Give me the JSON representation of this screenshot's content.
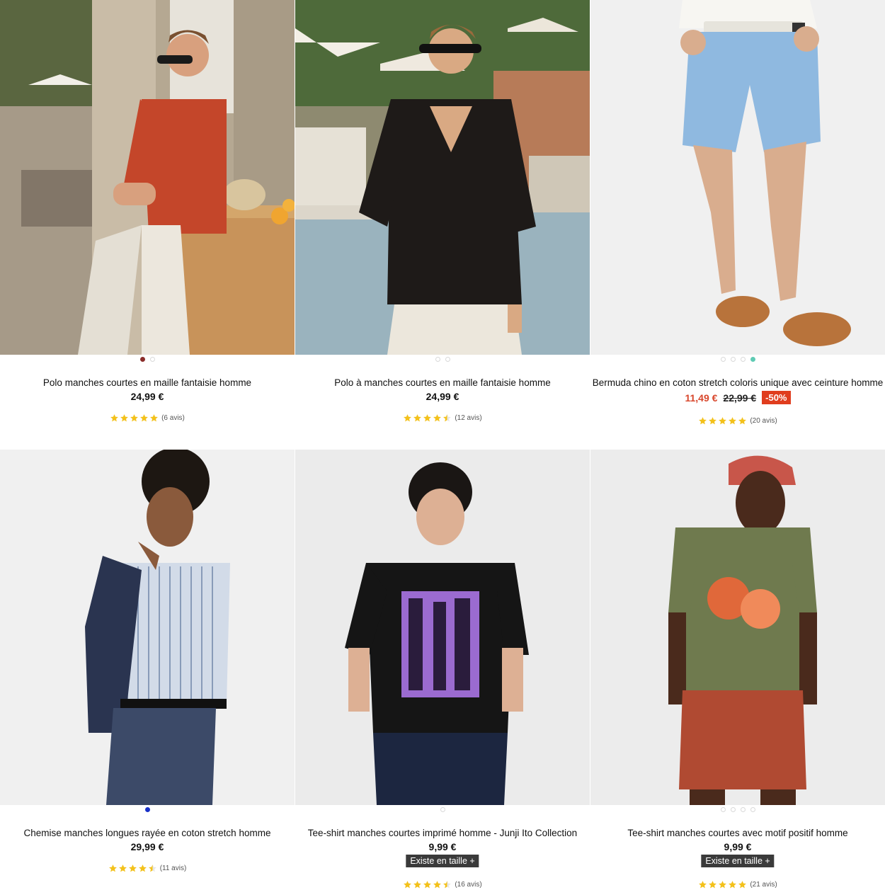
{
  "products": [
    {
      "name": "Polo manches courtes en maille fantaisie homme",
      "price": "24,99 €",
      "reviews": "(6 avis)"
    },
    {
      "name": "Polo à manches courtes en maille fantaisie homme",
      "price": "24,99 €",
      "reviews": "(12 avis)"
    },
    {
      "name": "Bermuda chino en coton stretch coloris unique avec ceinture homme",
      "price_sale": "11,49 €",
      "price_old": "22,99 €",
      "discount": "-50%",
      "reviews": "(20 avis)"
    },
    {
      "name": "Chemise manches longues rayée en coton stretch homme",
      "price": "29,99 €",
      "reviews": "(11 avis)"
    },
    {
      "name": "Tee-shirt manches courtes imprimé homme - Junji Ito Collection",
      "price": "9,99 €",
      "size_badge": "Existe en taille +",
      "reviews": "(16 avis)"
    },
    {
      "name": "Tee-shirt manches courtes avec motif positif homme",
      "price": "9,99 €",
      "size_badge": "Existe en taille +",
      "reviews": "(21 avis)"
    }
  ],
  "colors": {
    "accent_sale": "#d8462b",
    "discount_bg": "#e03d1e",
    "star": "#f3c11b",
    "badge_bg": "#3a3a3a",
    "swatch_1a": "#8b2d2a",
    "swatch_3d": "#5fcbb4",
    "swatch_4a": "#1830c8"
  }
}
